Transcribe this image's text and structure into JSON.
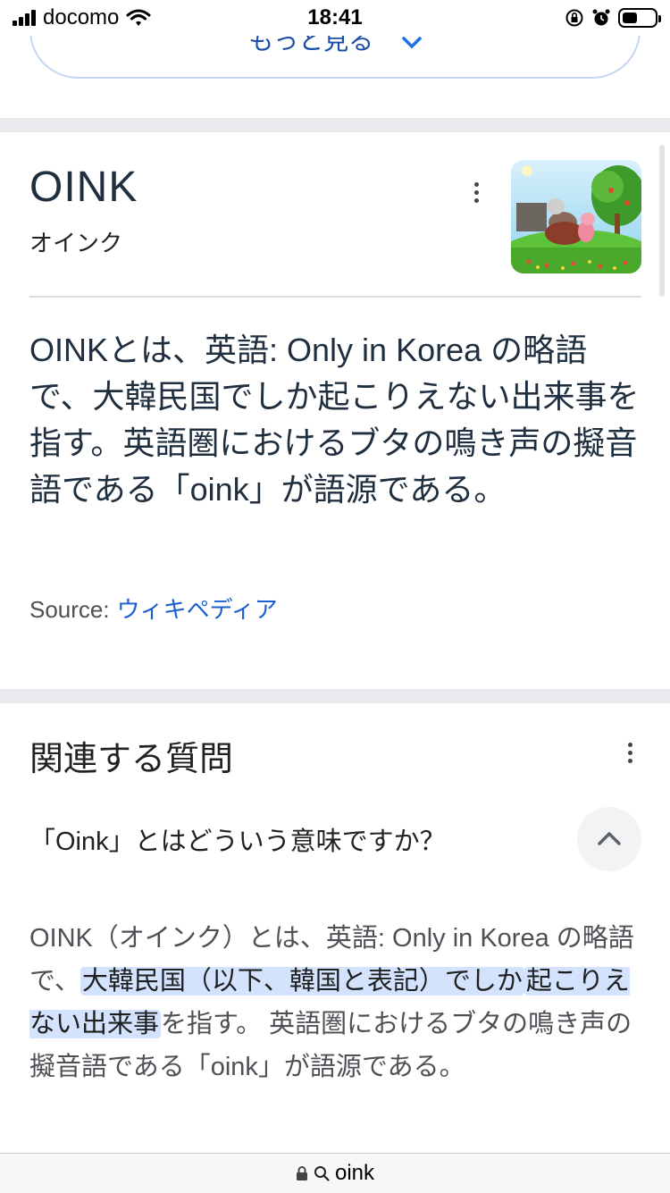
{
  "status_bar": {
    "carrier": "docomo",
    "time": "18:41"
  },
  "more_button": {
    "label": "もっと見る"
  },
  "knowledge_panel": {
    "title": "OINK",
    "subtitle": "オインク",
    "thumbnail_icon": "pig-cartoon-image",
    "description": "OINKとは、英語: Only in Korea の略語で、大韓民国でしか起こりえない出来事を指す。英語圏におけるブタの鳴き声の擬音語である「oink」が語源である。",
    "source_label": "Source:",
    "source_link": "ウィキペディア"
  },
  "related_questions": {
    "title": "関連する質問",
    "question": "「Oink」とはどういう意味ですか？",
    "answer_pre": "OINK（オインク）とは、英語: Only in Korea の略語で、",
    "answer_highlight_1": "大韓民国（以下、韓国と表記）でしか",
    "answer_highlight_2": "起こりえない出来事",
    "answer_post": "を指す。 英語圏におけるブタの鳴き声の擬音語である「oink」が語源である。"
  },
  "url_bar": {
    "query": "oink"
  },
  "colors": {
    "accent": "#1a73e8",
    "link": "#1a5fd1",
    "highlight": "#d3e3fd",
    "separator": "#e8eaed"
  }
}
